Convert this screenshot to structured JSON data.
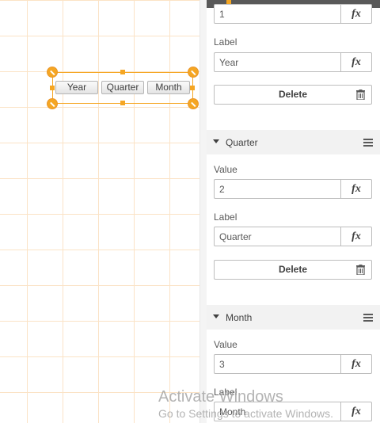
{
  "canvas": {
    "segmented_buttons": [
      "Year",
      "Quarter",
      "Month"
    ]
  },
  "panel": {
    "top_field": {
      "value": "1",
      "fx": "fx"
    },
    "year_item": {
      "label_caption": "Label",
      "label_value": "Year",
      "fx": "fx",
      "delete_label": "Delete"
    },
    "quarter_item": {
      "title": "Quarter",
      "value_caption": "Value",
      "value": "2",
      "label_caption": "Label",
      "label_value": "Quarter",
      "fx": "fx",
      "delete_label": "Delete"
    },
    "month_item": {
      "title": "Month",
      "value_caption": "Value",
      "value": "3",
      "label_caption": "Label",
      "label_value": "Month",
      "fx": "fx"
    }
  },
  "watermark": {
    "title": "Activate Windows",
    "subtitle": "Go to Settings to activate Windows."
  },
  "colors": {
    "accent": "#f5a623",
    "grid": "#fbe3c6",
    "section_bg": "#f2f2f2"
  }
}
